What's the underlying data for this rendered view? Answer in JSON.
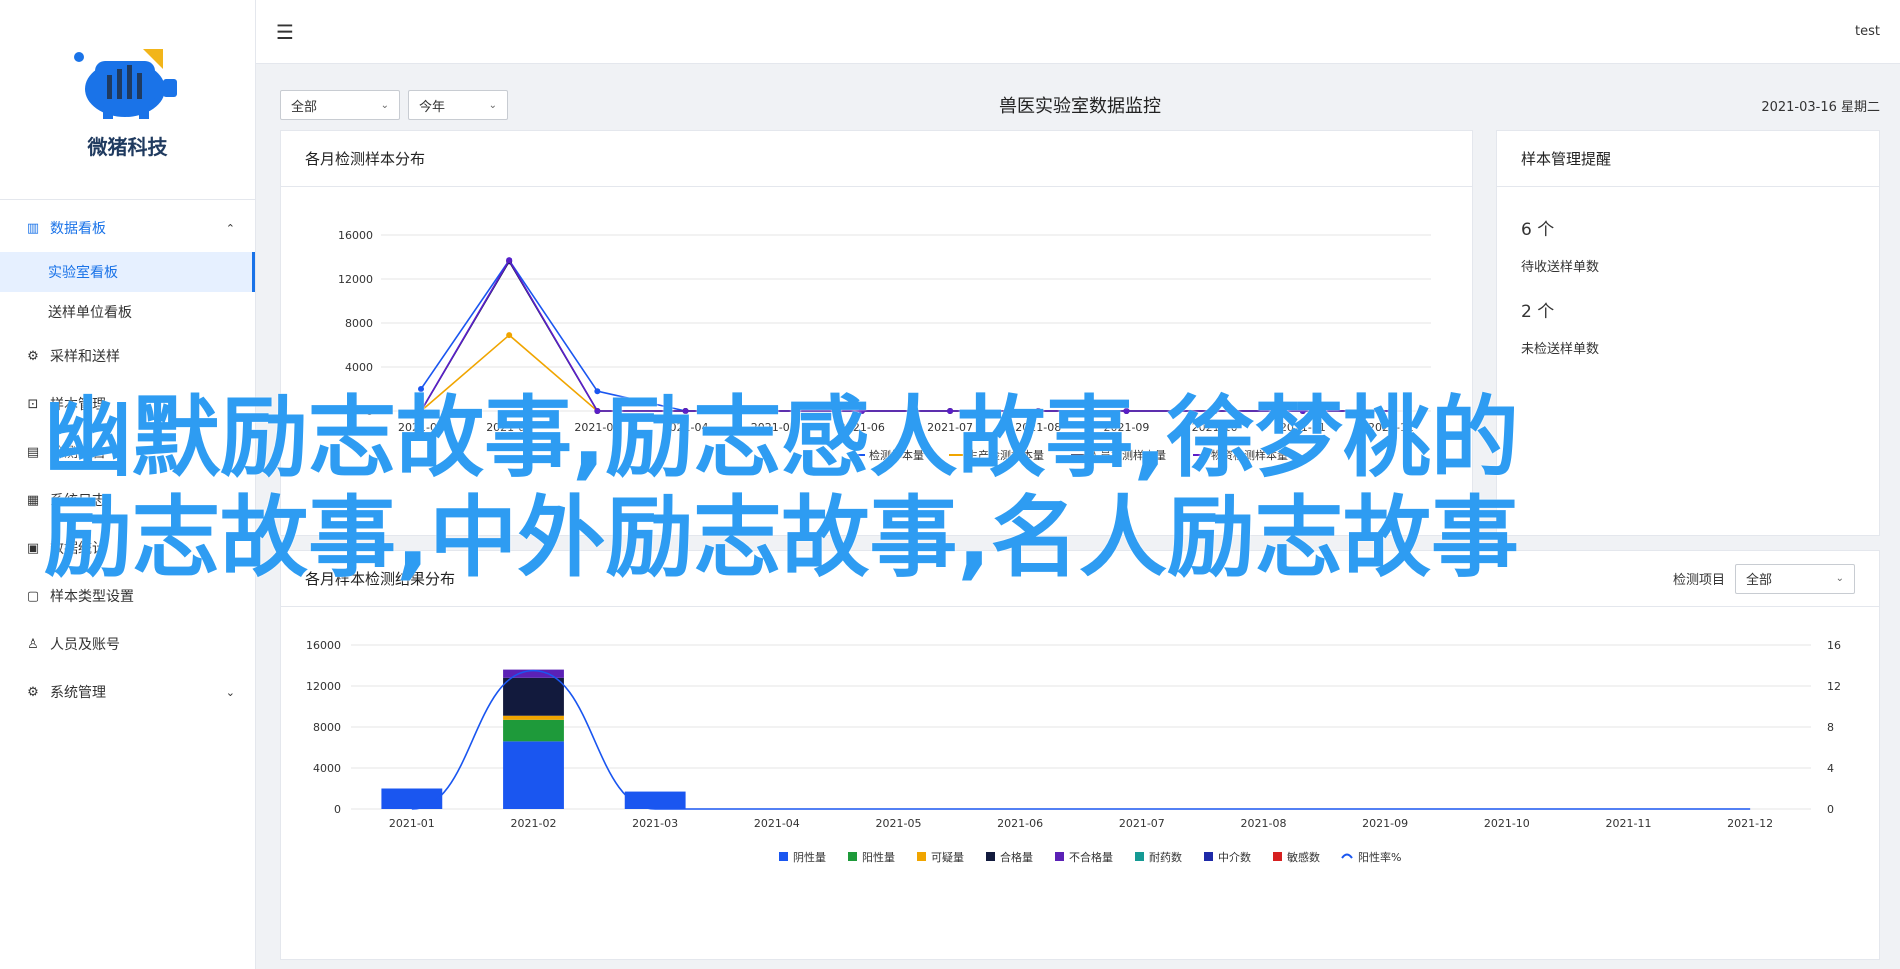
{
  "brand": {
    "name": "微猪科技",
    "accent": "#1a73e8",
    "logo_blue": "#1a73e8",
    "logo_yellow": "#f2b51a"
  },
  "header": {
    "menu_icon": "hamburger-icon",
    "user": "test"
  },
  "sidebar": {
    "items": [
      {
        "label": "数据看板",
        "icon": "bar-chart-icon",
        "expanded": true,
        "children": [
          {
            "label": "实验室看板",
            "active": true
          },
          {
            "label": "送样单位看板"
          }
        ]
      },
      {
        "label": "采样和送样",
        "icon": "sample-icon"
      },
      {
        "label": "样本管理",
        "icon": "box-icon"
      },
      {
        "label": "检测报告",
        "icon": "document-icon"
      },
      {
        "label": "系统日志",
        "icon": "log-icon"
      },
      {
        "label": "数据统计",
        "icon": "stats-icon"
      },
      {
        "label": "样本类型设置",
        "icon": "settings-icon"
      },
      {
        "label": "人员及账号",
        "icon": "user-icon"
      },
      {
        "label": "系统管理",
        "icon": "gear-icon",
        "expanded": false
      }
    ]
  },
  "filters": {
    "scope": "全部",
    "period": "今年"
  },
  "page": {
    "title": "兽医实验室数据监控",
    "date": "2021-03-16 星期二"
  },
  "chart1": {
    "title": "各月检测样本分布",
    "chart_data": {
      "type": "line",
      "categories": [
        "2021-01",
        "2021-02",
        "2021-03",
        "2021-04",
        "2021-05",
        "2021-06",
        "2021-07",
        "2021-08",
        "2021-09",
        "2021-10",
        "2021-11",
        "2021-12"
      ],
      "yticks": [
        0,
        4000,
        8000,
        12000,
        16000
      ],
      "ylim": [
        0,
        16000
      ],
      "series": [
        {
          "name": "检测样本量",
          "color": "#1a56f0",
          "values": [
            2000,
            13700,
            1800,
            0,
            0,
            0,
            0,
            0,
            0,
            0,
            0,
            0
          ]
        },
        {
          "name": "生产检测样本量",
          "color": "#f0a500",
          "values": [
            0,
            6900,
            0,
            0,
            0,
            0,
            0,
            0,
            0,
            0,
            0,
            0
          ]
        },
        {
          "name": "人员检测样本量",
          "color": "#0f1c45",
          "values": [
            0,
            13600,
            0,
            0,
            0,
            0,
            0,
            0,
            0,
            0,
            0,
            0
          ]
        },
        {
          "name": "物资检测样本量",
          "color": "#5a1ec8",
          "values": [
            0,
            13700,
            0,
            0,
            0,
            0,
            0,
            0,
            0,
            0,
            0,
            0
          ]
        }
      ]
    }
  },
  "remind": {
    "title": "样本管理提醒",
    "items": [
      {
        "count": "6 个",
        "label": "待收送样单数"
      },
      {
        "count": "2 个",
        "label": "未检送样单数"
      }
    ]
  },
  "chart2": {
    "title": "各月样本检测结果分布",
    "project_label": "检测项目",
    "project_value": "全部",
    "chart_data": {
      "type": "bar",
      "categories": [
        "2021-01",
        "2021-02",
        "2021-03",
        "2021-04",
        "2021-05",
        "2021-06",
        "2021-07",
        "2021-08",
        "2021-09",
        "2021-10",
        "2021-11",
        "2021-12"
      ],
      "yticks": [
        0,
        4000,
        8000,
        12000,
        16000
      ],
      "ylim": [
        0,
        16000
      ],
      "y2ticks": [
        0,
        4,
        8,
        12,
        16
      ],
      "y2lim": [
        0,
        16
      ],
      "series": [
        {
          "name": "阴性量",
          "color": "#1a56f0",
          "values": [
            2000,
            6600,
            1700,
            0,
            0,
            0,
            0,
            0,
            0,
            0,
            0,
            0
          ]
        },
        {
          "name": "阳性量",
          "color": "#1e9a3a",
          "values": [
            0,
            2100,
            0,
            0,
            0,
            0,
            0,
            0,
            0,
            0,
            0,
            0
          ]
        },
        {
          "name": "可疑量",
          "color": "#f0a500",
          "values": [
            0,
            400,
            0,
            0,
            0,
            0,
            0,
            0,
            0,
            0,
            0,
            0
          ]
        },
        {
          "name": "合格量",
          "color": "#121a3d",
          "values": [
            0,
            3700,
            0,
            0,
            0,
            0,
            0,
            0,
            0,
            0,
            0,
            0
          ]
        },
        {
          "name": "不合格量",
          "color": "#5b21b6",
          "values": [
            0,
            800,
            0,
            0,
            0,
            0,
            0,
            0,
            0,
            0,
            0,
            0
          ]
        },
        {
          "name": "耐药数",
          "color": "#159a94",
          "values": [
            0,
            0,
            0,
            0,
            0,
            0,
            0,
            0,
            0,
            0,
            0,
            0
          ]
        },
        {
          "name": "中介数",
          "color": "#1e2aa8",
          "values": [
            0,
            0,
            0,
            0,
            0,
            0,
            0,
            0,
            0,
            0,
            0,
            0
          ]
        },
        {
          "name": "敏感数",
          "color": "#d62020",
          "values": [
            0,
            0,
            0,
            0,
            0,
            0,
            0,
            0,
            0,
            0,
            0,
            0
          ]
        }
      ],
      "line_series": {
        "name": "阳性率%",
        "color": "#1a56f0",
        "values": [
          0,
          13.5,
          0,
          0,
          0,
          0,
          0,
          0,
          0,
          0,
          0,
          0
        ]
      }
    }
  },
  "overlay": {
    "line1": "幽默励志故事,励志感人故事,徐梦桃的",
    "line2": "励志故事,中外励志故事,名人励志故事",
    "color": "#2e9cf2"
  }
}
